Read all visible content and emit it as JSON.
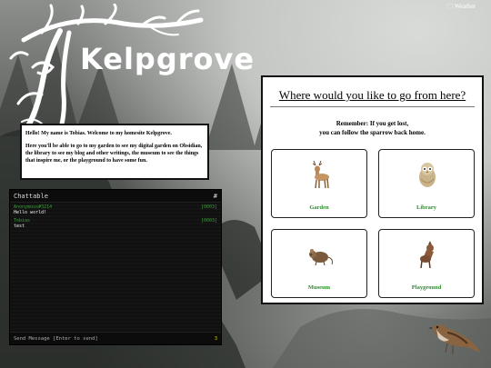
{
  "site": {
    "name": "Kelpgrove"
  },
  "weather": {
    "alt": "Weather"
  },
  "intro": {
    "line1": "Hello! My name is Tobias. Welcome to my homesite Kelpgrove.",
    "line2": "Here you'll be able to go to my garden to see my digital garden on Obsidian, the library to see my blog and other writings, the museum to see the things that inspire me, or the playground to have some fun."
  },
  "chat": {
    "title": "Chattable",
    "hash": "#",
    "messages": [
      {
        "user": "Anonymous#3214",
        "tag": "[0003]",
        "text": "Hello world!"
      },
      {
        "user": "Tobias",
        "tag": "[0003]",
        "text": "test"
      }
    ],
    "input_placeholder": "Send Message [Enter to send]",
    "count": "3"
  },
  "nav": {
    "title": "Where would you like to go from here?",
    "note_line1": "Remember: If you get lost,",
    "note_line2": "you can follow the sparrow back home.",
    "tiles": [
      {
        "label": "Garden",
        "icon": "deer-icon"
      },
      {
        "label": "Library",
        "icon": "owl-icon"
      },
      {
        "label": "Museum",
        "icon": "mouse-icon"
      },
      {
        "label": "Playground",
        "icon": "dog-icon"
      }
    ],
    "accent": "#2a8a2a"
  }
}
